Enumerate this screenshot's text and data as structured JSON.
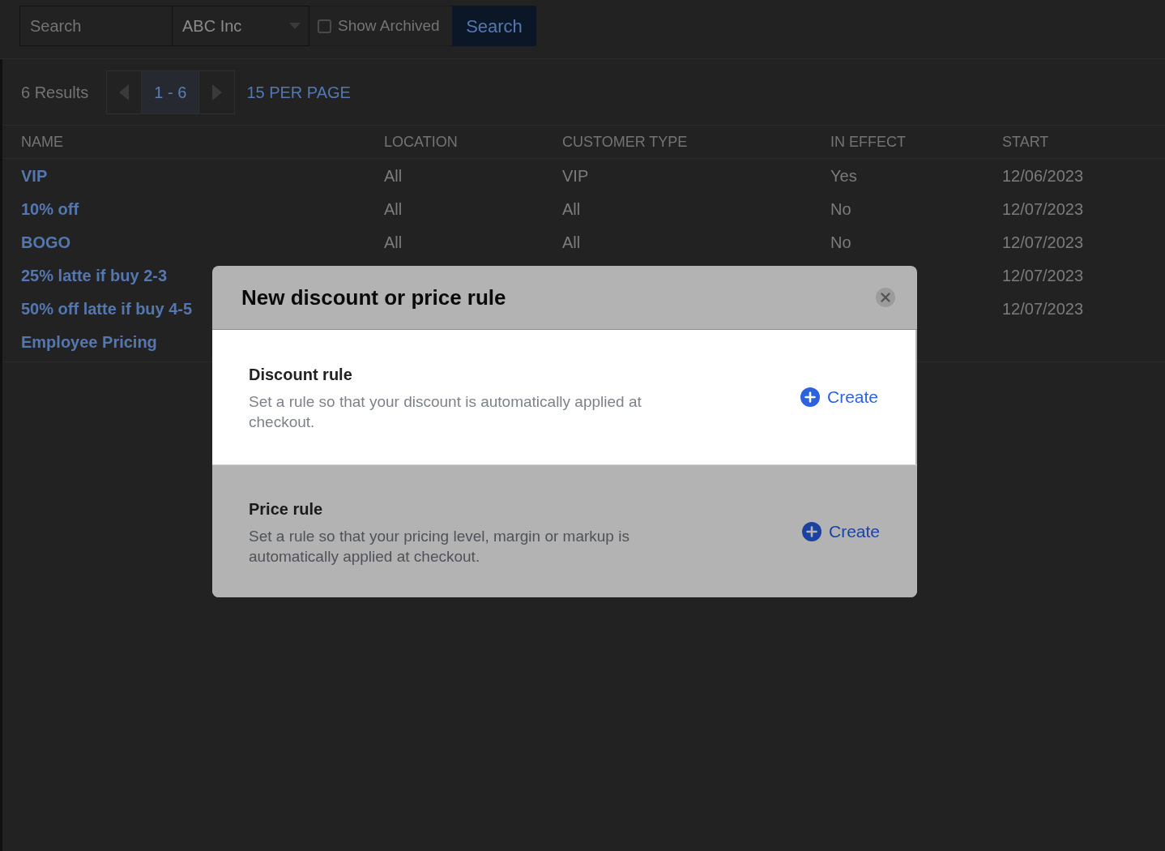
{
  "toolbar": {
    "search": {
      "placeholder": "Search"
    },
    "company_select": {
      "value": "ABC Inc"
    },
    "show_archived": {
      "label": "Show Archived",
      "checked": false
    },
    "search_button": "Search"
  },
  "pagination": {
    "results": "6 Results",
    "range": "1 - 6",
    "per_page": "15 PER PAGE"
  },
  "table": {
    "columns": [
      "NAME",
      "LOCATION",
      "CUSTOMER TYPE",
      "IN EFFECT",
      "START"
    ],
    "rows": [
      {
        "name": "VIP",
        "location": "All",
        "customer_type": "VIP",
        "in_effect": "Yes",
        "start": "12/06/2023"
      },
      {
        "name": "10% off",
        "location": "All",
        "customer_type": "All",
        "in_effect": "No",
        "start": "12/07/2023"
      },
      {
        "name": "BOGO",
        "location": "All",
        "customer_type": "All",
        "in_effect": "No",
        "start": "12/07/2023"
      },
      {
        "name": "25% latte if buy 2-3",
        "start": "12/07/2023"
      },
      {
        "name": "50% off latte if buy 4-5",
        "start": "12/07/2023"
      },
      {
        "name": "Employee Pricing"
      }
    ]
  },
  "modal": {
    "title": "New discount or price rule",
    "options": [
      {
        "title": "Discount rule",
        "description": "Set a rule so that your discount is automatically applied at checkout.",
        "action": "Create",
        "selected": true
      },
      {
        "title": "Price rule",
        "description": "Set a rule so that your pricing level, margin or markup is automatically applied at checkout.",
        "action": "Create",
        "selected": false
      }
    ]
  }
}
